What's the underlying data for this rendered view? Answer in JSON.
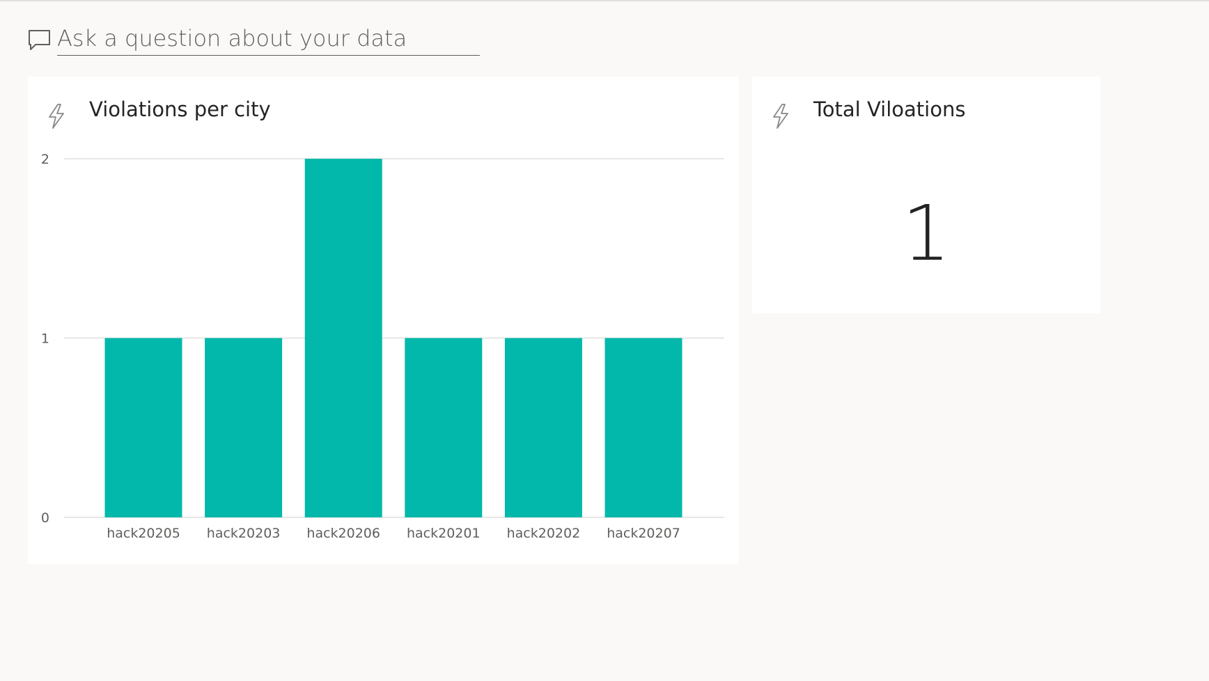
{
  "qna": {
    "placeholder": "Ask a question about your data",
    "icon": "chat-bubble-icon"
  },
  "chart_tile": {
    "title": "Violations per city",
    "icon": "lightning-bolt-icon"
  },
  "card_tile": {
    "title": "Total Viloations",
    "value": "1",
    "icon": "lightning-bolt-icon"
  },
  "colors": {
    "bar": "#01b8aa",
    "gridline": "#e1dfdd",
    "background": "#faf9f8",
    "tile": "#ffffff"
  },
  "chart_data": {
    "type": "bar",
    "categories": [
      "hack20205",
      "hack20203",
      "hack20206",
      "hack20201",
      "hack20202",
      "hack20207"
    ],
    "values": [
      1,
      1,
      2,
      1,
      1,
      1
    ],
    "title": "Violations per city",
    "xlabel": "",
    "ylabel": "",
    "ylim": [
      0,
      2
    ],
    "yticks": [
      0,
      1,
      2
    ],
    "grid": true,
    "legend": "none"
  }
}
